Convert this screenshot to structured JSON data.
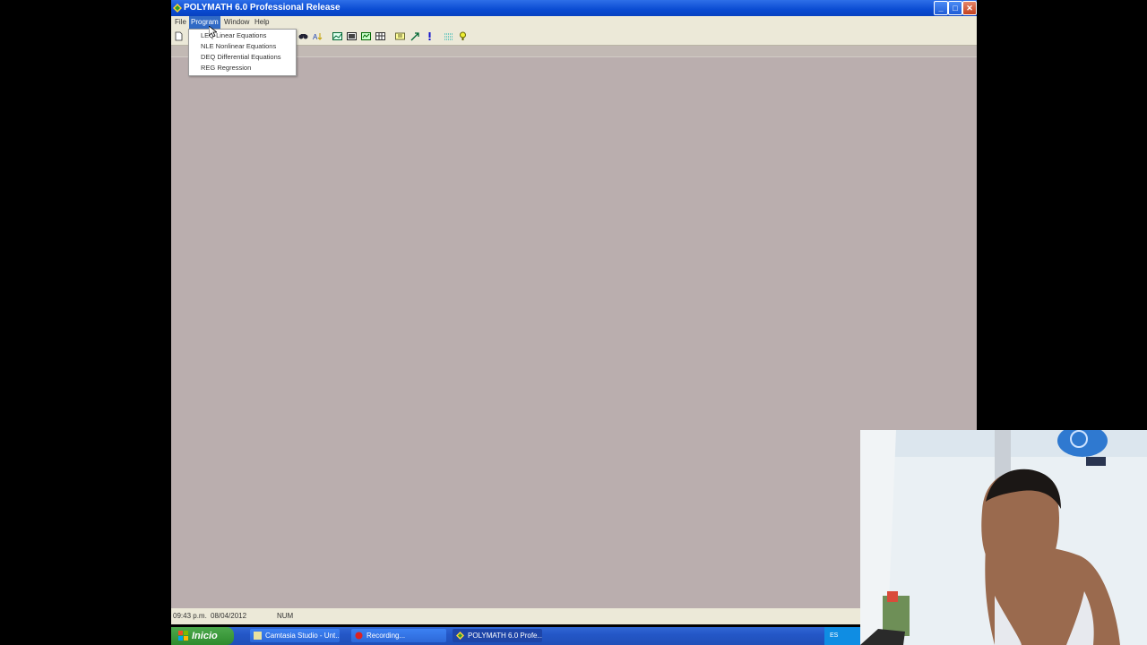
{
  "window": {
    "title": "POLYMATH 6.0 Professional Release",
    "controls": {
      "minimize": "_",
      "maximize": "□",
      "close": "✕"
    }
  },
  "menubar": {
    "items": [
      {
        "label": "File"
      },
      {
        "label": "Program"
      },
      {
        "label": "Window"
      },
      {
        "label": "Help"
      }
    ]
  },
  "program_menu": {
    "items": [
      {
        "label": "LEQ Linear Equations"
      },
      {
        "label": "NLE Nonlinear Equations"
      },
      {
        "label": "DEQ Differential Equations"
      },
      {
        "label": "REG Regression"
      }
    ]
  },
  "toolbar": {
    "icons": [
      "new-file-icon",
      "find-icon",
      "sort-icon",
      "graph-icon",
      "table-icon",
      "report-icon",
      "grid-icon",
      "calculator-icon",
      "arrow-icon",
      "exclamation-icon",
      "units-icon",
      "help-icon"
    ]
  },
  "statusbar": {
    "time": "09:43 p.m.",
    "date": "08/04/2012",
    "num": "NUM"
  },
  "taskbar": {
    "start_label": "Inicio",
    "buttons": [
      {
        "label": "Camtasia Studio - Unt..."
      },
      {
        "label": "Recording..."
      },
      {
        "label": "POLYMATH 6.0 Profe..."
      }
    ],
    "tray_language": "ES"
  },
  "colors": {
    "titlebar": "#0A4BD2",
    "client_bg": "#BAAEAE",
    "menu_highlight": "#316AC5",
    "taskbar": "#2457C7",
    "start_button": "#2E8B2E"
  }
}
